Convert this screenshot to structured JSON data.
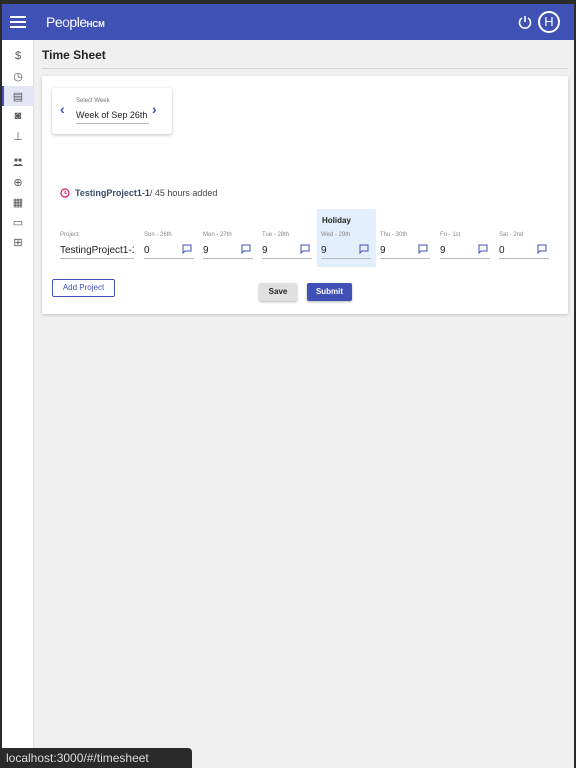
{
  "header": {
    "logo_main": "PeopleHCM",
    "logo_short": "HCM",
    "avatar_letter": "H"
  },
  "sidebar": {
    "items": [
      {
        "icon": "dollar-icon",
        "glyph": "$"
      },
      {
        "icon": "clock-icon",
        "glyph": "◷"
      },
      {
        "icon": "timesheet-icon",
        "glyph": "▤",
        "active": true
      },
      {
        "icon": "id-card-icon",
        "glyph": "◙"
      },
      {
        "icon": "tree-icon",
        "glyph": "⊥"
      },
      {
        "icon": "people-icon",
        "glyph": "👥"
      },
      {
        "icon": "globe-icon",
        "glyph": "⊕"
      },
      {
        "icon": "list-icon",
        "glyph": "▦"
      },
      {
        "icon": "briefcase-icon",
        "glyph": "▭"
      },
      {
        "icon": "calendar-add-icon",
        "glyph": "⊞"
      }
    ]
  },
  "page": {
    "title": "Time Sheet"
  },
  "week_selector": {
    "label": "Select Week",
    "value": "Week of Sep 26th"
  },
  "summary": {
    "project": "TestingProject1-1",
    "hours_text": "/ 45 hours added"
  },
  "holiday_label": "Holiday",
  "row": {
    "project_label": "Project",
    "project_value": "TestingProject1-1",
    "days": [
      {
        "label": "Sun - 26th",
        "value": "0"
      },
      {
        "label": "Mon - 27th",
        "value": "9"
      },
      {
        "label": "Tue - 28th",
        "value": "9"
      },
      {
        "label": "Wed - 29th",
        "value": "9"
      },
      {
        "label": "Thu - 30th",
        "value": "9"
      },
      {
        "label": "Fri - 1st",
        "value": "9"
      },
      {
        "label": "Sat - 2nd",
        "value": "0"
      }
    ]
  },
  "buttons": {
    "add_project": "Add Project",
    "save": "Save",
    "submit": "Submit"
  },
  "statusbar": {
    "url": "localhost:3000/#/timesheet"
  },
  "colors": {
    "primary": "#3f51b5",
    "holiday_bg": "#e3effc",
    "alert": "#d81b60"
  }
}
